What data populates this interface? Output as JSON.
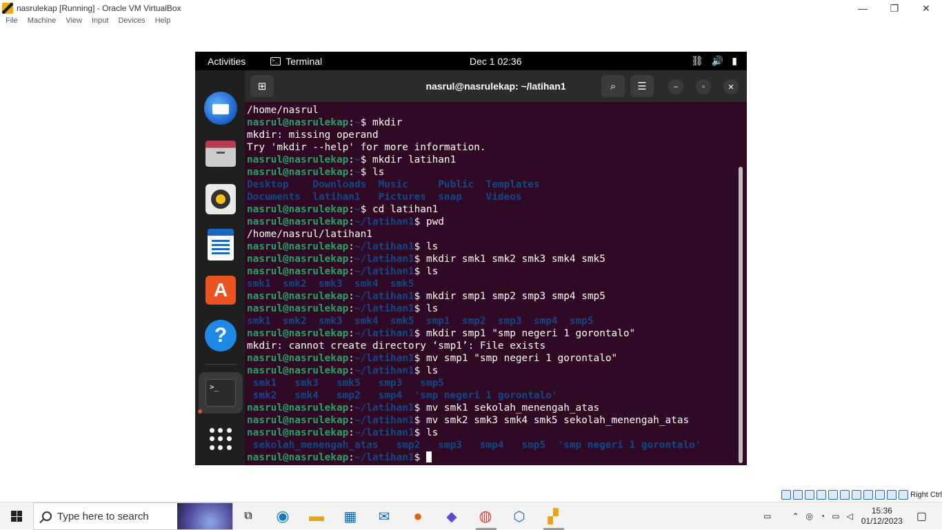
{
  "vbox": {
    "window_title": "nasrulekap [Running] - Oracle VM VirtualBox",
    "menu": [
      "File",
      "Machine",
      "View",
      "Input",
      "Devices",
      "Help"
    ],
    "controls": {
      "minimize": "—",
      "restore": "❐",
      "close": "✕"
    },
    "host_key": "Right Ctrl"
  },
  "gnome": {
    "activities": "Activities",
    "app_name": "Terminal",
    "clock": "Dec 1  02:36"
  },
  "terminal": {
    "title": "nasrul@nasrulekap: ~/latihan1",
    "lines": [
      {
        "output": "/home/nasrul"
      },
      {
        "user": "nasrul@nasrulekap",
        "path": "~",
        "cmd": "mkdir"
      },
      {
        "output": "mkdir: missing operand"
      },
      {
        "output": "Try 'mkdir --help' for more information."
      },
      {
        "user": "nasrul@nasrulekap",
        "path": "~",
        "cmd": "mkdir latihan1"
      },
      {
        "user": "nasrul@nasrulekap",
        "path": "~",
        "cmd": "ls"
      },
      {
        "dirs": "Desktop    Downloads  Music     Public  Templates"
      },
      {
        "dirs": "Documents  latihan1   Pictures  snap    Videos"
      },
      {
        "user": "nasrul@nasrulekap",
        "path": "~",
        "cmd": "cd latihan1"
      },
      {
        "user": "nasrul@nasrulekap",
        "path": "~/latihan1",
        "cmd": "pwd"
      },
      {
        "output": "/home/nasrul/latihan1"
      },
      {
        "user": "nasrul@nasrulekap",
        "path": "~/latihan1",
        "cmd": "ls"
      },
      {
        "user": "nasrul@nasrulekap",
        "path": "~/latihan1",
        "cmd": "mkdir smk1 smk2 smk3 smk4 smk5"
      },
      {
        "user": "nasrul@nasrulekap",
        "path": "~/latihan1",
        "cmd": "ls"
      },
      {
        "dirs": "smk1  smk2  smk3  smk4  smk5"
      },
      {
        "user": "nasrul@nasrulekap",
        "path": "~/latihan1",
        "cmd": "mkdir smp1 smp2 smp3 smp4 smp5"
      },
      {
        "user": "nasrul@nasrulekap",
        "path": "~/latihan1",
        "cmd": "ls"
      },
      {
        "dirs": "smk1  smk2  smk3  smk4  smk5  smp1  smp2  smp3  smp4  smp5"
      },
      {
        "user": "nasrul@nasrulekap",
        "path": "~/latihan1",
        "cmd": "mkdir smp1 \"smp negeri 1 gorontalo\""
      },
      {
        "output": "mkdir: cannot create directory ‘smp1’: File exists"
      },
      {
        "user": "nasrul@nasrulekap",
        "path": "~/latihan1",
        "cmd": "mv smp1 \"smp negeri 1 gorontalo\""
      },
      {
        "user": "nasrul@nasrulekap",
        "path": "~/latihan1",
        "cmd": "ls"
      },
      {
        "dirs": " smk1   smk3   smk5   smp3   smp5"
      },
      {
        "dirs": " smk2   smk4   smp2   smp4  'smp negeri 1 gorontalo'"
      },
      {
        "user": "nasrul@nasrulekap",
        "path": "~/latihan1",
        "cmd": "mv smk1 sekolah_menengah_atas"
      },
      {
        "user": "nasrul@nasrulekap",
        "path": "~/latihan1",
        "cmd": "mv smk2 smk3 smk4 smk5 sekolah_menengah_atas"
      },
      {
        "user": "nasrul@nasrulekap",
        "path": "~/latihan1",
        "cmd": "ls"
      },
      {
        "dirs": " sekolah_menengah_atas   smp2   smp3   smp4   smp5  'smp negeri 1 gorontalo'"
      },
      {
        "user": "nasrul@nasrulekap",
        "path": "~/latihan1",
        "cmd": "",
        "cursor": true
      }
    ]
  },
  "taskbar": {
    "search_placeholder": "Type here to search",
    "time": "15:36",
    "date": "01/12/2023"
  },
  "colors": {
    "terminal_bg": "#300a24",
    "prompt_user": "#26a269",
    "prompt_path": "#12488b",
    "dir_listing": "#12488b"
  }
}
